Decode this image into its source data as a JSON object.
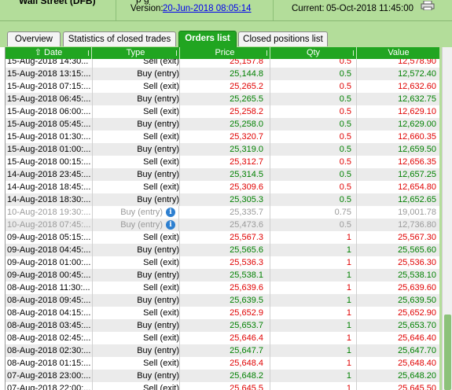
{
  "header": {
    "instrument": "Wall Street (DFB)",
    "partial_title": "p  g",
    "version_label": "Version:",
    "version_value": "20-Jun-2018 08:05:14",
    "current_label": "Current:",
    "current_value": "05-Oct-2018 11:45:00"
  },
  "tabs": [
    {
      "label": "Overview"
    },
    {
      "label": "Statistics of closed trades"
    },
    {
      "label": "Orders list"
    },
    {
      "label": "Closed positions list"
    }
  ],
  "columns": {
    "date": "Date",
    "type": "Type",
    "price": "Price",
    "qty": "Qty",
    "value": "Value"
  },
  "sort_icon": "up-arrow-icon",
  "colors": {
    "sell": "#e00000",
    "buy": "#008000",
    "disabled": "#9a9a9a",
    "header_green": "#21a521"
  },
  "rows": [
    {
      "date": "15-Aug-2018 14:30...",
      "type": "Sell (exit)",
      "price": "25,157.8",
      "qty": "0.5",
      "value": "12,578.90",
      "side": "sell"
    },
    {
      "date": "15-Aug-2018 13:15:...",
      "type": "Buy (entry)",
      "price": "25,144.8",
      "qty": "0.5",
      "value": "12,572.40",
      "side": "buy"
    },
    {
      "date": "15-Aug-2018 07:15:...",
      "type": "Sell (exit)",
      "price": "25,265.2",
      "qty": "0.5",
      "value": "12,632.60",
      "side": "sell"
    },
    {
      "date": "15-Aug-2018 06:45:...",
      "type": "Buy (entry)",
      "price": "25,265.5",
      "qty": "0.5",
      "value": "12,632.75",
      "side": "buy"
    },
    {
      "date": "15-Aug-2018 06:00:...",
      "type": "Sell (exit)",
      "price": "25,258.2",
      "qty": "0.5",
      "value": "12,629.10",
      "side": "sell"
    },
    {
      "date": "15-Aug-2018 05:45:...",
      "type": "Buy (entry)",
      "price": "25,258.0",
      "qty": "0.5",
      "value": "12,629.00",
      "side": "buy"
    },
    {
      "date": "15-Aug-2018 01:30:...",
      "type": "Sell (exit)",
      "price": "25,320.7",
      "qty": "0.5",
      "value": "12,660.35",
      "side": "sell"
    },
    {
      "date": "15-Aug-2018 01:00:...",
      "type": "Buy (entry)",
      "price": "25,319.0",
      "qty": "0.5",
      "value": "12,659.50",
      "side": "buy"
    },
    {
      "date": "15-Aug-2018 00:15:...",
      "type": "Sell (exit)",
      "price": "25,312.7",
      "qty": "0.5",
      "value": "12,656.35",
      "side": "sell"
    },
    {
      "date": "14-Aug-2018 23:45:...",
      "type": "Buy (entry)",
      "price": "25,314.5",
      "qty": "0.5",
      "value": "12,657.25",
      "side": "buy"
    },
    {
      "date": "14-Aug-2018 18:45:...",
      "type": "Sell (exit)",
      "price": "25,309.6",
      "qty": "0.5",
      "value": "12,654.80",
      "side": "sell"
    },
    {
      "date": "14-Aug-2018 18:30:...",
      "type": "Buy (entry)",
      "price": "25,305.3",
      "qty": "0.5",
      "value": "12,652.65",
      "side": "buy"
    },
    {
      "date": "10-Aug-2018 19:30:...",
      "type": "Buy (entry)",
      "price": "25,335.7",
      "qty": "0.75",
      "value": "19,001.78",
      "side": "gray",
      "info": true
    },
    {
      "date": "10-Aug-2018 07:45:...",
      "type": "Buy (entry)",
      "price": "25,473.6",
      "qty": "0.5",
      "value": "12,736.80",
      "side": "gray",
      "info": true
    },
    {
      "date": "09-Aug-2018 05:15:...",
      "type": "Sell (exit)",
      "price": "25,567.3",
      "qty": "1",
      "value": "25,567.30",
      "side": "sell"
    },
    {
      "date": "09-Aug-2018 04:45:...",
      "type": "Buy (entry)",
      "price": "25,565.6",
      "qty": "1",
      "value": "25,565.60",
      "side": "buy"
    },
    {
      "date": "09-Aug-2018 01:00:...",
      "type": "Sell (exit)",
      "price": "25,536.3",
      "qty": "1",
      "value": "25,536.30",
      "side": "sell"
    },
    {
      "date": "09-Aug-2018 00:45:...",
      "type": "Buy (entry)",
      "price": "25,538.1",
      "qty": "1",
      "value": "25,538.10",
      "side": "buy"
    },
    {
      "date": "08-Aug-2018 11:30:...",
      "type": "Sell (exit)",
      "price": "25,639.6",
      "qty": "1",
      "value": "25,639.60",
      "side": "sell"
    },
    {
      "date": "08-Aug-2018 09:45:...",
      "type": "Buy (entry)",
      "price": "25,639.5",
      "qty": "1",
      "value": "25,639.50",
      "side": "buy"
    },
    {
      "date": "08-Aug-2018 04:15:...",
      "type": "Sell (exit)",
      "price": "25,652.9",
      "qty": "1",
      "value": "25,652.90",
      "side": "sell"
    },
    {
      "date": "08-Aug-2018 03:45:...",
      "type": "Buy (entry)",
      "price": "25,653.7",
      "qty": "1",
      "value": "25,653.70",
      "side": "buy"
    },
    {
      "date": "08-Aug-2018 02:45:...",
      "type": "Sell (exit)",
      "price": "25,646.4",
      "qty": "1",
      "value": "25,646.40",
      "side": "sell"
    },
    {
      "date": "08-Aug-2018 02:30:...",
      "type": "Buy (entry)",
      "price": "25,647.7",
      "qty": "1",
      "value": "25,647.70",
      "side": "buy"
    },
    {
      "date": "08-Aug-2018 01:15:...",
      "type": "Sell (exit)",
      "price": "25,648.4",
      "qty": "1",
      "value": "25,648.40",
      "side": "sell"
    },
    {
      "date": "07-Aug-2018 23:00:...",
      "type": "Buy (entry)",
      "price": "25,648.2",
      "qty": "1",
      "value": "25,648.20",
      "side": "buy"
    },
    {
      "date": "07-Aug-2018 22:00:...",
      "type": "Sell (exit)",
      "price": "25,645.5",
      "qty": "1",
      "value": "25,645.50",
      "side": "sell"
    }
  ]
}
